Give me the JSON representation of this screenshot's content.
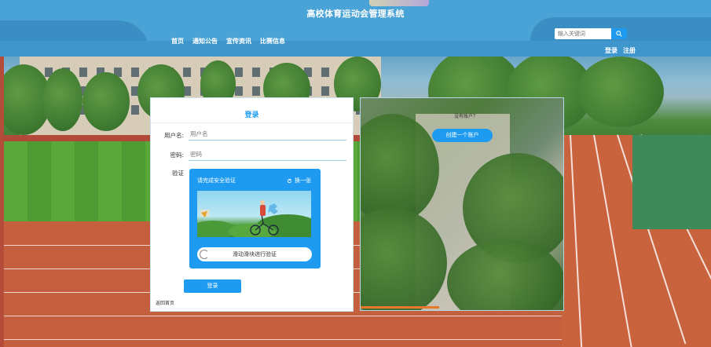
{
  "header": {
    "title": "高校体育运动会管理系统",
    "nav": [
      "首页",
      "通知公告",
      "宣传资讯",
      "比赛信息"
    ],
    "search_placeholder": "输入关键词",
    "auth_links": [
      "登录",
      "注册"
    ],
    "search_icon": "search-icon"
  },
  "login": {
    "title": "登录",
    "username_label": "用户名:",
    "username_placeholder": "用户名",
    "password_label": "密码:",
    "password_placeholder": "密码",
    "captcha_label": "验证",
    "captcha_hint": "请完成安全验证",
    "refresh_label": "换一张",
    "slider_text": "滑动滑块进行验证",
    "submit_label": "登录",
    "back_home": "返回首页"
  },
  "register_panel": {
    "prompt": "没有账户？",
    "create_label": "创建一个账户"
  },
  "colors": {
    "accent": "#1e9bf0",
    "header_bg": "#4aa3d6"
  }
}
